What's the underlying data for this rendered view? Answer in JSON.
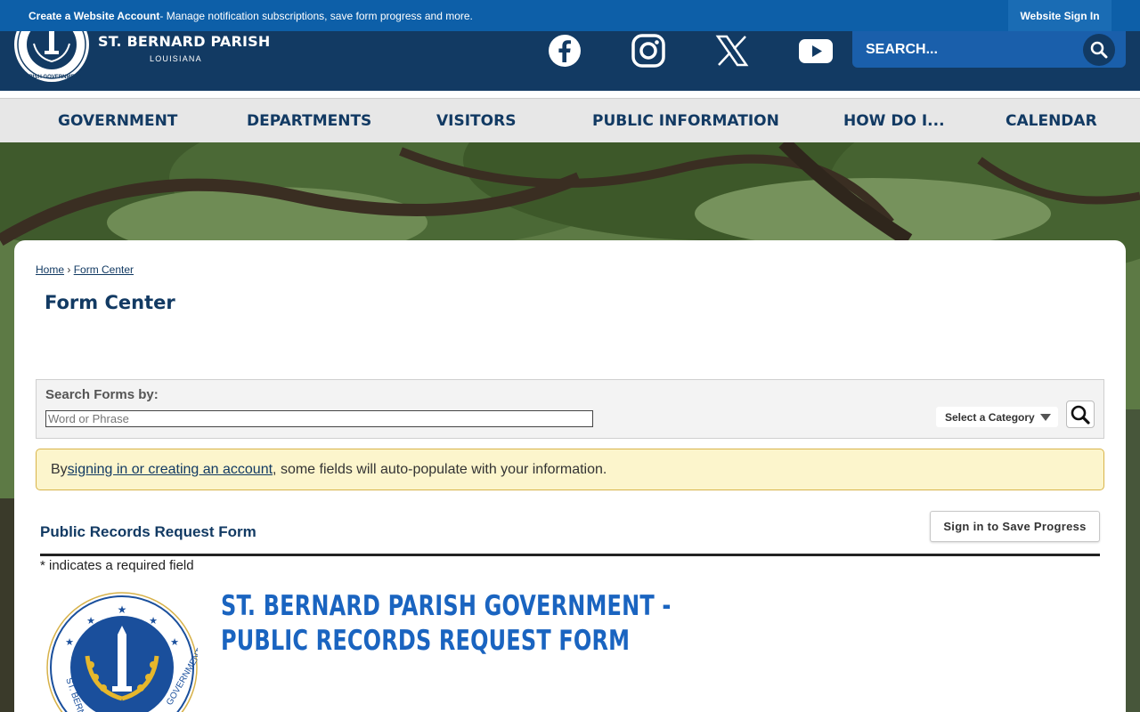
{
  "topbar": {
    "create_label": "Create a Website Account",
    "create_desc": " - Manage notification subscriptions, save form progress and more.",
    "signin_label": "Website Sign In"
  },
  "header": {
    "title": "ST. BERNARD PARISH",
    "subtitle": "LOUISIANA",
    "seal_text": "ST. BERNARD PARISH GOVERNMENT",
    "social": [
      "facebook-icon",
      "instagram-icon",
      "x-icon",
      "youtube-icon"
    ],
    "search_placeholder": "SEARCH..."
  },
  "nav": {
    "items": [
      "GOVERNMENT",
      "DEPARTMENTS",
      "VISITORS",
      "PUBLIC INFORMATION",
      "HOW DO I...",
      "CALENDAR"
    ]
  },
  "breadcrumb": {
    "home": "Home",
    "sep": " › ",
    "current": "Form Center"
  },
  "page": {
    "title": "Form Center"
  },
  "search_forms": {
    "label": "Search Forms by:",
    "placeholder": "Word or Phrase",
    "category": "Select a Category"
  },
  "notice": {
    "prefix": "By ",
    "link": "signing in or creating an account",
    "suffix": ", some fields will auto-populate with your information."
  },
  "form": {
    "title": "Public Records Request Form",
    "save_label": "Sign in to Save Progress",
    "required_note": "* indicates a required field",
    "heading": "ST. BERNARD PARISH GOVERNMENT - PUBLIC RECORDS REQUEST FORM",
    "seal_text": "ST. BERNARD PARISH GOVERNMENT"
  },
  "colors": {
    "topbar": "#0d5fa8",
    "header": "#123a63",
    "nav_bg": "#e7e7e7",
    "heading_blue": "#1a64c0",
    "notice_bg": "#fcf5cc"
  }
}
